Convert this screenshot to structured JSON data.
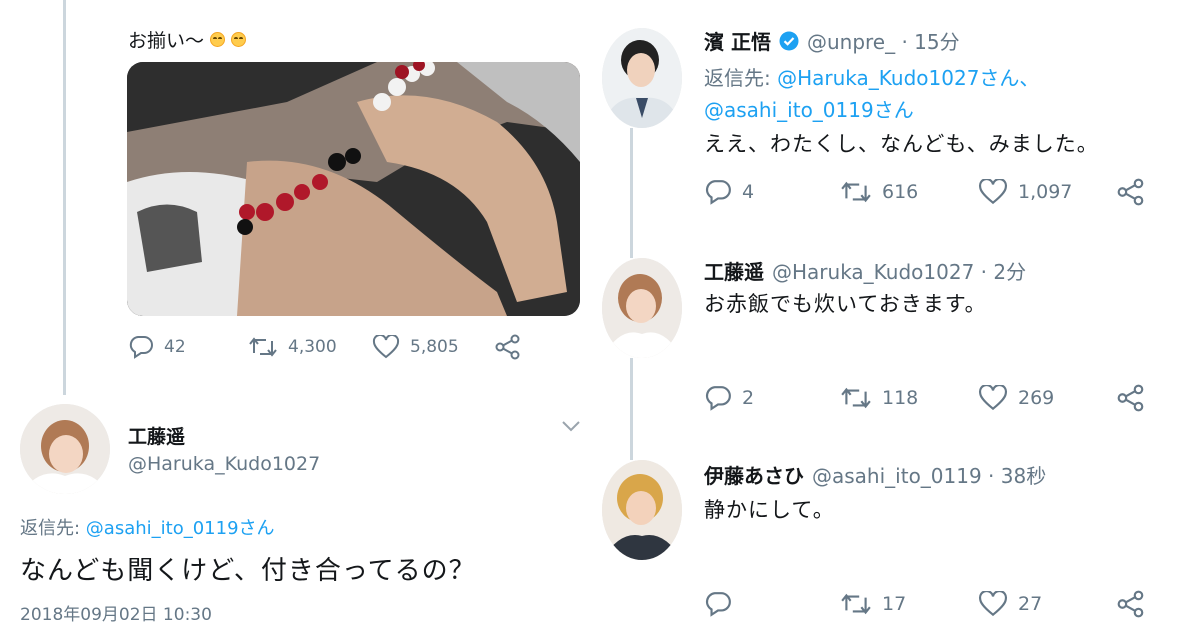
{
  "left": {
    "tweet1": {
      "text": "お揃い〜",
      "emoji": [
        "smiling-face-icon",
        "smiling-face-icon"
      ],
      "reply_count": "42",
      "retweet_count": "4,300",
      "like_count": "5,805"
    },
    "tweet2": {
      "name": "工藤遥",
      "handle": "@Haruka_Kudo1027",
      "reply_to_label": "返信先: ",
      "reply_to_user": "@asahi_ito_0119さん",
      "body": "なんども聞くけど、付き合ってるの？",
      "datetime": "2018年09月02日 10:30"
    }
  },
  "right": {
    "tweets": [
      {
        "name": "濱 正悟",
        "verified": true,
        "handle_time": "@unpre_ · 15分",
        "reply_to_label": "返信先: ",
        "reply_to_user1": "@Haruka_Kudo1027さん、",
        "reply_to_user2": "@asahi_ito_0119さん",
        "body": "ええ、わたくし、なんども、みました。",
        "reply_count": "4",
        "retweet_count": "616",
        "like_count": "1,097"
      },
      {
        "name": "工藤遥",
        "handle_time": "@Haruka_Kudo1027 · 2分",
        "body": "お赤飯でも炊いておきます。",
        "reply_count": "2",
        "retweet_count": "118",
        "like_count": "269"
      },
      {
        "name": "伊藤あさひ",
        "handle_time": "@asahi_ito_0119 · 38秒",
        "body": "静かにして。",
        "reply_count": "",
        "retweet_count": "17",
        "like_count": "27"
      }
    ]
  },
  "colors": {
    "text": "#14171a",
    "secondary": "#657786",
    "link": "#1da1f2",
    "thread_line": "#ccd6dd"
  }
}
